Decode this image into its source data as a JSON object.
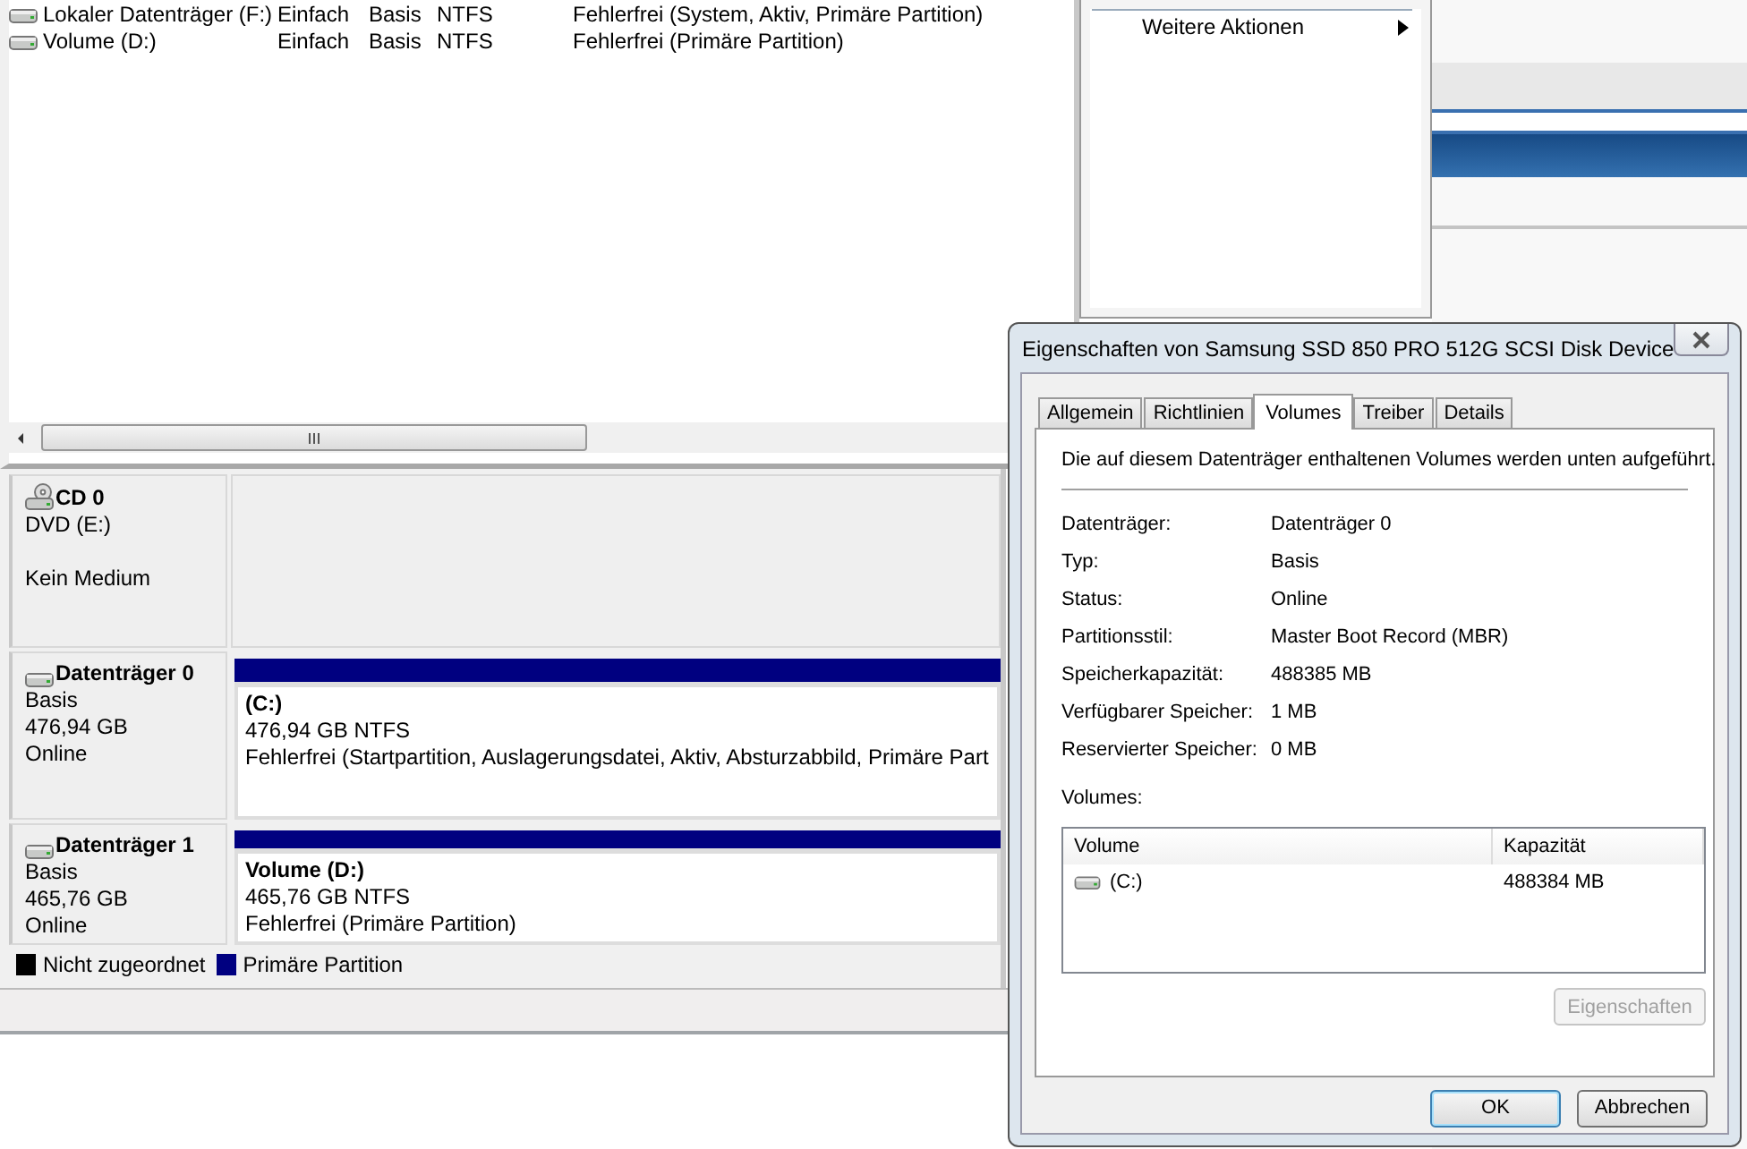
{
  "volume_list": {
    "rows": [
      {
        "volume": "Lokaler Datenträger (F:)",
        "layout": "Einfach",
        "type": "Basis",
        "filesystem": "NTFS",
        "status": "Fehlerfrei (System, Aktiv, Primäre Partition)"
      },
      {
        "volume": "Volume (D:)",
        "layout": "Einfach",
        "type": "Basis",
        "filesystem": "NTFS",
        "status": "Fehlerfrei (Primäre Partition)"
      }
    ]
  },
  "action_pane": {
    "items": [
      {
        "label": "Weitere Aktionen",
        "has_submenu": true
      }
    ]
  },
  "disk_map": {
    "disks": [
      {
        "kind": "cdrom",
        "name": "CD 0",
        "type": "DVD (E:)",
        "status": "Kein Medium"
      },
      {
        "kind": "disk",
        "name": "Datenträger 0",
        "type": "Basis",
        "size": "476,94 GB",
        "status": "Online",
        "partitions": [
          {
            "kind": "primary",
            "label": "(C:)",
            "size_fs": "476,94 GB NTFS",
            "status": "Fehlerfrei (Startpartition, Auslagerungsdatei, Aktiv, Absturzabbild, Primäre Part"
          }
        ]
      },
      {
        "kind": "disk",
        "name": "Datenträger 1",
        "type": "Basis",
        "size": "465,76 GB",
        "status": "Online",
        "partitions": [
          {
            "kind": "primary",
            "label": "Volume  (D:)",
            "size_fs": "465,76 GB NTFS",
            "status": "Fehlerfrei (Primäre Partition)"
          }
        ]
      }
    ],
    "legend": [
      {
        "label": "Nicht zugeordnet",
        "color": "#000000"
      },
      {
        "label": "Primäre Partition",
        "color": "#000080"
      }
    ]
  },
  "dialog": {
    "title": "Eigenschaften von Samsung SSD 850 PRO 512G SCSI Disk Device",
    "tabs": [
      {
        "label": "Allgemein",
        "selected": false
      },
      {
        "label": "Richtlinien",
        "selected": false
      },
      {
        "label": "Volumes",
        "selected": true
      },
      {
        "label": "Treiber",
        "selected": false
      },
      {
        "label": "Details",
        "selected": false
      }
    ],
    "description": "Die auf diesem Datenträger enthaltenen Volumes werden unten aufgeführt.",
    "fields": [
      {
        "label": "Datenträger:",
        "value": "Datenträger 0"
      },
      {
        "label": "Typ:",
        "value": "Basis"
      },
      {
        "label": "Status:",
        "value": "Online"
      },
      {
        "label": "Partitionsstil:",
        "value": "Master Boot Record (MBR)"
      },
      {
        "label": "Speicherkapazität:",
        "value": "488385 MB"
      },
      {
        "label": "Verfügbarer Speicher:",
        "value": "1 MB"
      },
      {
        "label": "Reservierter Speicher:",
        "value": "0 MB"
      }
    ],
    "volumes_label": "Volumes:",
    "volumes_table": {
      "columns": [
        "Volume",
        "Kapazität"
      ],
      "rows": [
        {
          "volume": "(C:)",
          "capacity": "488384 MB",
          "selected": false
        }
      ]
    },
    "properties_button": {
      "label": "Eigenschaften",
      "disabled": true
    },
    "buttons": [
      {
        "label": "OK",
        "default": true
      },
      {
        "label": "Abbrechen",
        "default": false
      }
    ]
  }
}
